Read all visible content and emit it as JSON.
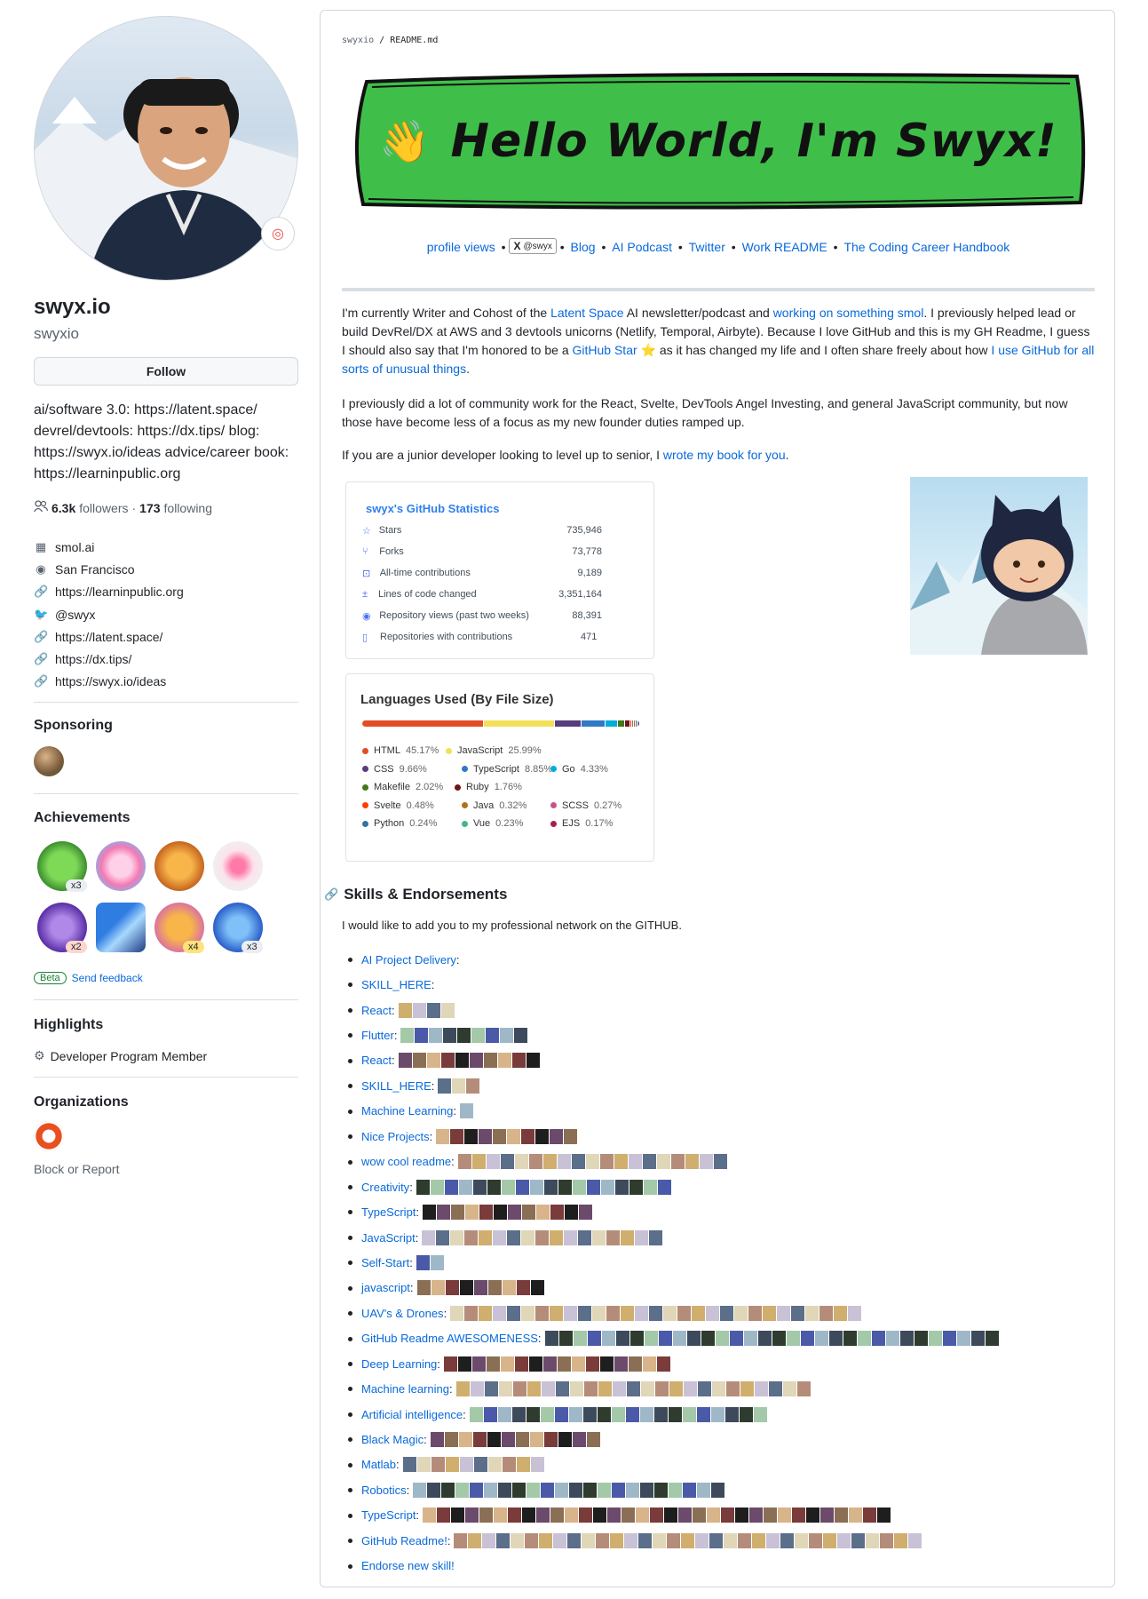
{
  "profile": {
    "name": "swyx.io",
    "login": "swyxio",
    "follow_label": "Follow",
    "bio": "ai/software 3.0: https://latent.space/ devrel/devtools: https://dx.tips/ blog: https://swyx.io/ideas advice/career book: https://learninpublic.org",
    "followers_count": "6.3k",
    "followers_label": "followers",
    "following_count": "173",
    "following_label": "following",
    "company": "smol.ai",
    "location": "San Francisco",
    "website": "https://learninpublic.org",
    "twitter": "@swyx",
    "links": [
      "https://latent.space/",
      "https://dx.tips/",
      "https://swyx.io/ideas"
    ]
  },
  "sidebar": {
    "sponsoring_title": "Sponsoring",
    "achievements_title": "Achievements",
    "achievement_counts": [
      "x3",
      "x2",
      "x4",
      "x3"
    ],
    "beta_label": "Beta",
    "feedback_label": "Send feedback",
    "highlights_title": "Highlights",
    "highlight_item": "Developer Program Member",
    "organizations_title": "Organizations",
    "block_label": "Block or Report"
  },
  "readme": {
    "path_user": "swyxio",
    "path_file": "README.md",
    "banner_text": "Hello World, I'm Swyx!",
    "banner_emoji": "👋",
    "links": {
      "profile_views": "profile views",
      "x_badge": "@swyx",
      "blog": "Blog",
      "podcast": "AI Podcast",
      "twitter": "Twitter",
      "work": "Work README",
      "handbook": "The Coding Career Handbook"
    },
    "p1": {
      "t1": "I'm currently Writer and Cohost of the ",
      "l1": "Latent Space",
      "t2": " AI newsletter/podcast and ",
      "l2": "working on something smol",
      "t3": ". I previously helped lead or build DevRel/DX at AWS and 3 devtools unicorns (Netlify, Temporal, Airbyte). Because I love GitHub and this is my GH Readme, I guess I should also say that I'm honored to be a ",
      "l3": "GitHub Star ⭐",
      "t4": " as it has changed my life and I often share freely about how ",
      "l4": "I use GitHub for all sorts of unusual things",
      "t5": "."
    },
    "p2": "I previously did a lot of community work for the React, Svelte, DevTools Angel Investing, and general JavaScript community, but now those have become less of a focus as my new founder duties ramped up.",
    "p3": {
      "t1": "If you are a junior developer looking to level up to senior, I ",
      "l1": "wrote my book for you",
      "t2": "."
    }
  },
  "stats": {
    "title": "swyx's GitHub Statistics",
    "rows": [
      {
        "icon": "star-icon",
        "label": "Stars",
        "value": "735,946"
      },
      {
        "icon": "fork-icon",
        "label": "Forks",
        "value": "73,778"
      },
      {
        "icon": "contributions-icon",
        "label": "All-time contributions",
        "value": "9,189"
      },
      {
        "icon": "diff-icon",
        "label": "Lines of code changed",
        "value": "3,351,164"
      },
      {
        "icon": "eye-icon",
        "label": "Repository views (past two weeks)",
        "value": "88,391"
      },
      {
        "icon": "repo-icon",
        "label": "Repositories with contributions",
        "value": "471"
      }
    ]
  },
  "languages": {
    "title": "Languages Used (By File Size)",
    "items": [
      {
        "name": "HTML",
        "pct": "45.17%",
        "value": 45.17,
        "color": "#e34c26"
      },
      {
        "name": "JavaScript",
        "pct": "25.99%",
        "value": 25.99,
        "color": "#f1e05a"
      },
      {
        "name": "CSS",
        "pct": "9.66%",
        "value": 9.66,
        "color": "#563d7c"
      },
      {
        "name": "TypeScript",
        "pct": "8.85%",
        "value": 8.85,
        "color": "#3178c6"
      },
      {
        "name": "Go",
        "pct": "4.33%",
        "value": 4.33,
        "color": "#00ADD8"
      },
      {
        "name": "Makefile",
        "pct": "2.02%",
        "value": 2.02,
        "color": "#427819"
      },
      {
        "name": "Ruby",
        "pct": "1.76%",
        "value": 1.76,
        "color": "#701516"
      },
      {
        "name": "Svelte",
        "pct": "0.48%",
        "value": 0.48,
        "color": "#ff3e00"
      },
      {
        "name": "Java",
        "pct": "0.32%",
        "value": 0.32,
        "color": "#b07219"
      },
      {
        "name": "SCSS",
        "pct": "0.27%",
        "value": 0.27,
        "color": "#c6538c"
      },
      {
        "name": "Python",
        "pct": "0.24%",
        "value": 0.24,
        "color": "#3572A5"
      },
      {
        "name": "Vue",
        "pct": "0.23%",
        "value": 0.23,
        "color": "#41b883"
      },
      {
        "name": "EJS",
        "pct": "0.17%",
        "value": 0.17,
        "color": "#a91e50"
      }
    ]
  },
  "skills": {
    "title": "Skills & Endorsements",
    "intro": "I would like to add you to my professional network on the GITHUB.",
    "items": [
      {
        "label": "AI Project Delivery",
        "n": 0
      },
      {
        "label": "SKILL_HERE",
        "n": 0
      },
      {
        "label": "React",
        "n": 4
      },
      {
        "label": "Flutter",
        "n": 9
      },
      {
        "label": "React",
        "n": 10
      },
      {
        "label": "SKILL_HERE",
        "n": 3
      },
      {
        "label": "Machine Learning",
        "n": 1
      },
      {
        "label": "Nice Projects",
        "n": 10
      },
      {
        "label": "wow cool readme",
        "n": 19
      },
      {
        "label": "Creativity",
        "n": 18
      },
      {
        "label": "TypeScript",
        "n": 12
      },
      {
        "label": "JavaScript",
        "n": 17
      },
      {
        "label": "Self-Start",
        "n": 2
      },
      {
        "label": "javascript",
        "n": 9
      },
      {
        "label": "UAV's & Drones",
        "n": 29
      },
      {
        "label": "GitHub Readme AWESOMENESS",
        "n": 32
      },
      {
        "label": "Deep Learning",
        "n": 16
      },
      {
        "label": "Machine learning",
        "n": 25
      },
      {
        "label": "Artificial intelligence",
        "n": 21
      },
      {
        "label": "Black Magic",
        "n": 12
      },
      {
        "label": "Matlab",
        "n": 10
      },
      {
        "label": "Robotics",
        "n": 22
      },
      {
        "label": "TypeScript",
        "n": 33
      },
      {
        "label": "GitHub Readme! ",
        "n": 33
      },
      {
        "label": "Endorse new skill!",
        "n": 0
      }
    ]
  }
}
